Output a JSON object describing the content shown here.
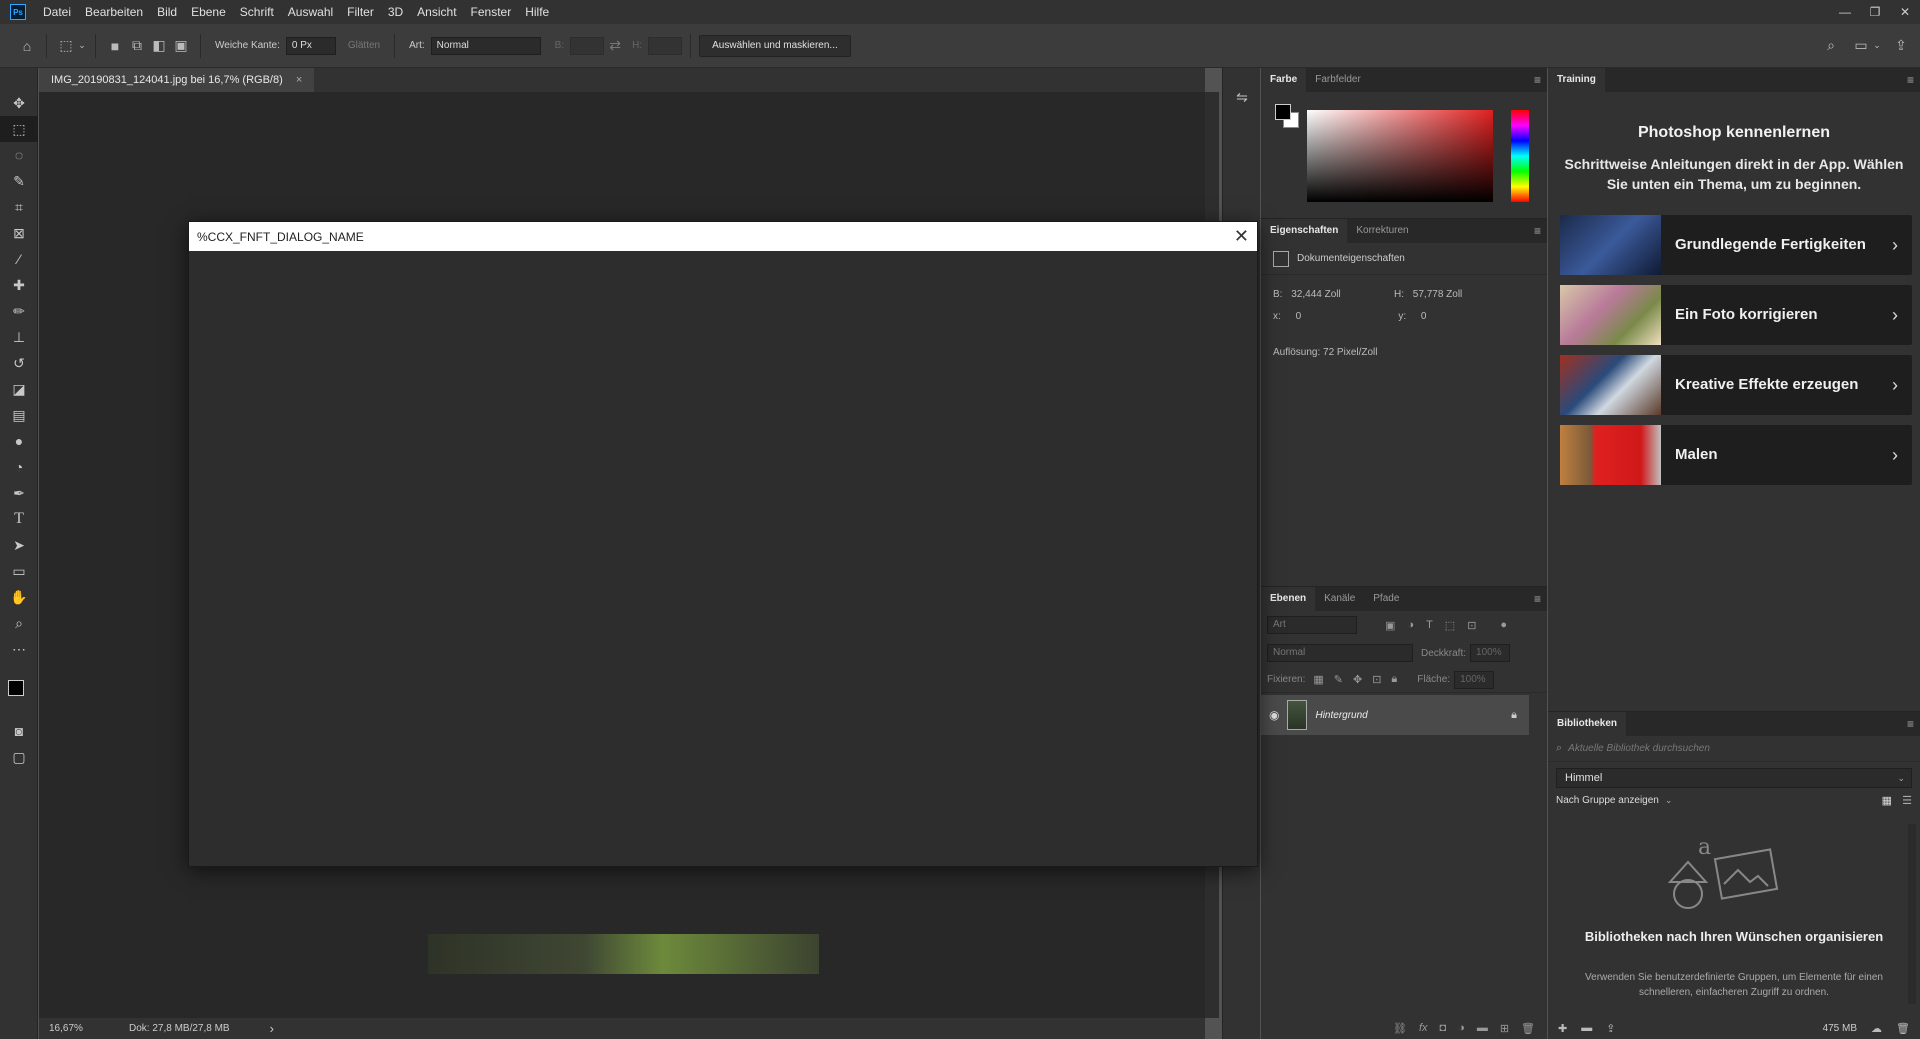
{
  "menubar": {
    "logo": "Ps",
    "items": [
      "Datei",
      "Bearbeiten",
      "Bild",
      "Ebene",
      "Schrift",
      "Auswahl",
      "Filter",
      "3D",
      "Ansicht",
      "Fenster",
      "Hilfe"
    ],
    "window_controls": [
      "—",
      "❐",
      "✕"
    ]
  },
  "options": {
    "feather_label": "Weiche Kante:",
    "feather_value": "0 Px",
    "antialias_label": "Glätten",
    "style_label": "Art:",
    "style_value": "Normal",
    "width_label": "B:",
    "height_label": "H:",
    "select_mask_button": "Auswählen und maskieren..."
  },
  "document": {
    "tab_title": "IMG_20190831_124041.jpg bei 16,7% (RGB/8)",
    "tab_close": "×",
    "zoom": "16,67%",
    "doc_size": "Dok: 27,8 MB/27,8 MB",
    "status_arrow": "›"
  },
  "dialog": {
    "title": "%CCX_FNFT_DIALOG_NAME",
    "close": "✕"
  },
  "color_panel": {
    "tabs": [
      "Farbe",
      "Farbfelder"
    ],
    "foreground": "#000000",
    "background": "#ffffff",
    "hue_color": "#e02020"
  },
  "properties_panel": {
    "tabs": [
      "Eigenschaften",
      "Korrekturen"
    ],
    "section": "Dokumenteigenschaften",
    "w_label": "B:",
    "w_value": "32,444 Zoll",
    "h_label": "H:",
    "h_value": "57,778 Zoll",
    "x_label": "x:",
    "x_value": "0",
    "y_label": "y:",
    "y_value": "0",
    "resolution": "Auflösung: 72 Pixel/Zoll"
  },
  "layers_panel": {
    "tabs": [
      "Ebenen",
      "Kanäle",
      "Pfade"
    ],
    "filter_placeholder": "Art",
    "blend_mode": "Normal",
    "opacity_label": "Deckkraft:",
    "opacity_value": "100%",
    "lock_label": "Fixieren:",
    "fill_label": "Fläche:",
    "fill_value": "100%",
    "layer_name": "Hintergrund"
  },
  "training_panel": {
    "tab": "Training",
    "heading": "Photoshop kennenlernen",
    "subtitle": "Schrittweise Anleitungen direkt in der App. Wählen Sie unten ein Thema, um zu beginnen.",
    "cards": [
      {
        "label": "Grundlegende Fertigkeiten"
      },
      {
        "label": "Ein Foto korrigieren"
      },
      {
        "label": "Kreative Effekte erzeugen"
      },
      {
        "label": "Malen"
      }
    ]
  },
  "libraries_panel": {
    "tab": "Bibliotheken",
    "search_placeholder": "Aktuelle Bibliothek durchsuchen",
    "library_name": "Himmel",
    "group_by": "Nach Gruppe anzeigen",
    "empty_heading": "Bibliotheken nach Ihren Wünschen organisieren",
    "empty_text": "Verwenden Sie benutzerdefinierte Gruppen, um Elemente für einen schnelleren, einfacheren Zugriff zu ordnen.",
    "storage": "475 MB"
  }
}
